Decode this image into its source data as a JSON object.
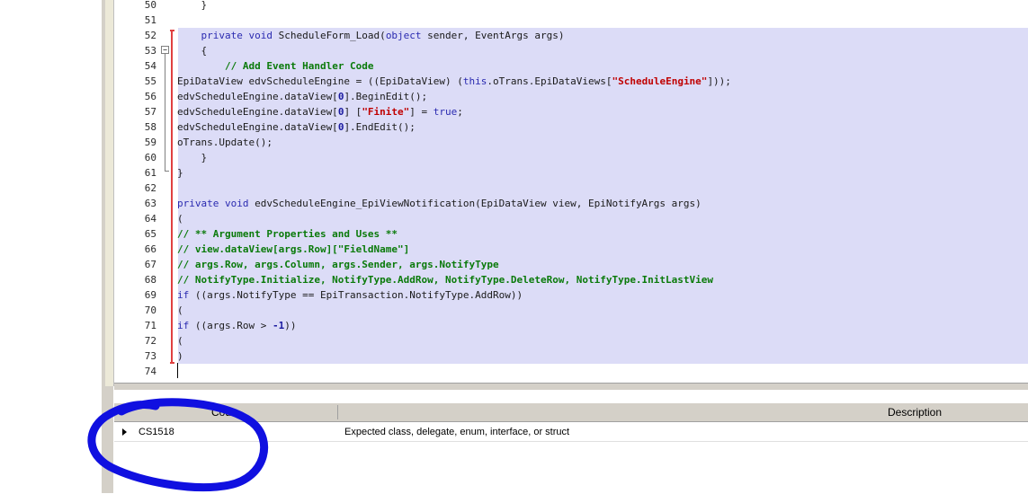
{
  "editor": {
    "line_numbers": [
      "50",
      "51",
      "52",
      "53",
      "54",
      "55",
      "56",
      "57",
      "58",
      "59",
      "60",
      "61",
      "62",
      "63",
      "64",
      "65",
      "66",
      "67",
      "68",
      "69",
      "70",
      "71",
      "72",
      "73",
      "74"
    ],
    "lines": [
      {
        "indent": "    ",
        "parts": [
          {
            "t": "}",
            "c": "p"
          }
        ]
      },
      {
        "indent": "",
        "parts": []
      },
      {
        "indent": "    ",
        "parts": [
          {
            "t": "private void ",
            "c": "kw"
          },
          {
            "t": "ScheduleForm_Load(",
            "c": "p"
          },
          {
            "t": "object ",
            "c": "kw"
          },
          {
            "t": "sender, EventArgs args)",
            "c": "p"
          }
        ]
      },
      {
        "indent": "    ",
        "parts": [
          {
            "t": "{",
            "c": "p"
          }
        ]
      },
      {
        "indent": "        ",
        "parts": [
          {
            "t": "// Add Event Handler Code",
            "c": "cm"
          }
        ]
      },
      {
        "indent": "",
        "parts": [
          {
            "t": "EpiDataView edvScheduleEngine = ((EpiDataView) (",
            "c": "p"
          },
          {
            "t": "this",
            "c": "kw"
          },
          {
            "t": ".oTrans.EpiDataViews[",
            "c": "p"
          },
          {
            "t": "\"ScheduleEngine\"",
            "c": "str"
          },
          {
            "t": "]));",
            "c": "p"
          }
        ]
      },
      {
        "indent": "",
        "parts": [
          {
            "t": "edvScheduleEngine.dataView[",
            "c": "p"
          },
          {
            "t": "0",
            "c": "num"
          },
          {
            "t": "].BeginEdit();",
            "c": "p"
          }
        ]
      },
      {
        "indent": "",
        "parts": [
          {
            "t": "edvScheduleEngine.dataView[",
            "c": "p"
          },
          {
            "t": "0",
            "c": "num"
          },
          {
            "t": "] [",
            "c": "p"
          },
          {
            "t": "\"Finite\"",
            "c": "str"
          },
          {
            "t": "] = ",
            "c": "p"
          },
          {
            "t": "true",
            "c": "kw"
          },
          {
            "t": ";",
            "c": "p"
          }
        ]
      },
      {
        "indent": "",
        "parts": [
          {
            "t": "edvScheduleEngine.dataView[",
            "c": "p"
          },
          {
            "t": "0",
            "c": "num"
          },
          {
            "t": "].EndEdit();",
            "c": "p"
          }
        ]
      },
      {
        "indent": "",
        "parts": [
          {
            "t": "oTrans.Update();",
            "c": "p"
          }
        ]
      },
      {
        "indent": "    ",
        "parts": [
          {
            "t": "}",
            "c": "p"
          }
        ]
      },
      {
        "indent": "",
        "parts": [
          {
            "t": "}",
            "c": "p"
          }
        ]
      },
      {
        "indent": "",
        "parts": []
      },
      {
        "indent": "",
        "parts": [
          {
            "t": "private void ",
            "c": "kw"
          },
          {
            "t": "edvScheduleEngine_EpiViewNotification(EpiDataView view, EpiNotifyArgs args)",
            "c": "p"
          }
        ]
      },
      {
        "indent": "",
        "parts": [
          {
            "t": "(",
            "c": "p"
          }
        ]
      },
      {
        "indent": "",
        "parts": [
          {
            "t": "// ** Argument Properties and Uses **",
            "c": "cm"
          }
        ]
      },
      {
        "indent": "",
        "parts": [
          {
            "t": "// view.dataView[args.Row][\"FieldName\"]",
            "c": "cm"
          }
        ]
      },
      {
        "indent": "",
        "parts": [
          {
            "t": "// args.Row, args.Column, args.Sender, args.NotifyType",
            "c": "cm"
          }
        ]
      },
      {
        "indent": "",
        "parts": [
          {
            "t": "// NotifyType.Initialize, NotifyType.AddRow, NotifyType.DeleteRow, NotifyType.InitLastView",
            "c": "cm"
          }
        ]
      },
      {
        "indent": "",
        "parts": [
          {
            "t": "if ",
            "c": "kw"
          },
          {
            "t": "((args.NotifyType == EpiTransaction.NotifyType.AddRow))",
            "c": "p"
          }
        ]
      },
      {
        "indent": "",
        "parts": [
          {
            "t": "(",
            "c": "p"
          }
        ]
      },
      {
        "indent": "",
        "parts": [
          {
            "t": "if ",
            "c": "kw"
          },
          {
            "t": "((args.Row > ",
            "c": "p"
          },
          {
            "t": "-1",
            "c": "num"
          },
          {
            "t": "))",
            "c": "p"
          }
        ]
      },
      {
        "indent": "",
        "parts": [
          {
            "t": "(",
            "c": "p"
          }
        ]
      },
      {
        "indent": "",
        "parts": [
          {
            "t": ")",
            "c": "p"
          }
        ]
      },
      {
        "indent": "",
        "parts": []
      }
    ]
  },
  "error_list": {
    "columns": {
      "code": "Code",
      "description": "Description"
    },
    "rows": [
      {
        "code": "CS1518",
        "description": "Expected class, delegate, enum, interface, or struct"
      }
    ]
  },
  "colors": {
    "selection": "#dcdcf7",
    "keyword": "#2a2ab0",
    "comment": "#0a7a0a",
    "string": "#c00000",
    "annotation": "#1010e0"
  }
}
